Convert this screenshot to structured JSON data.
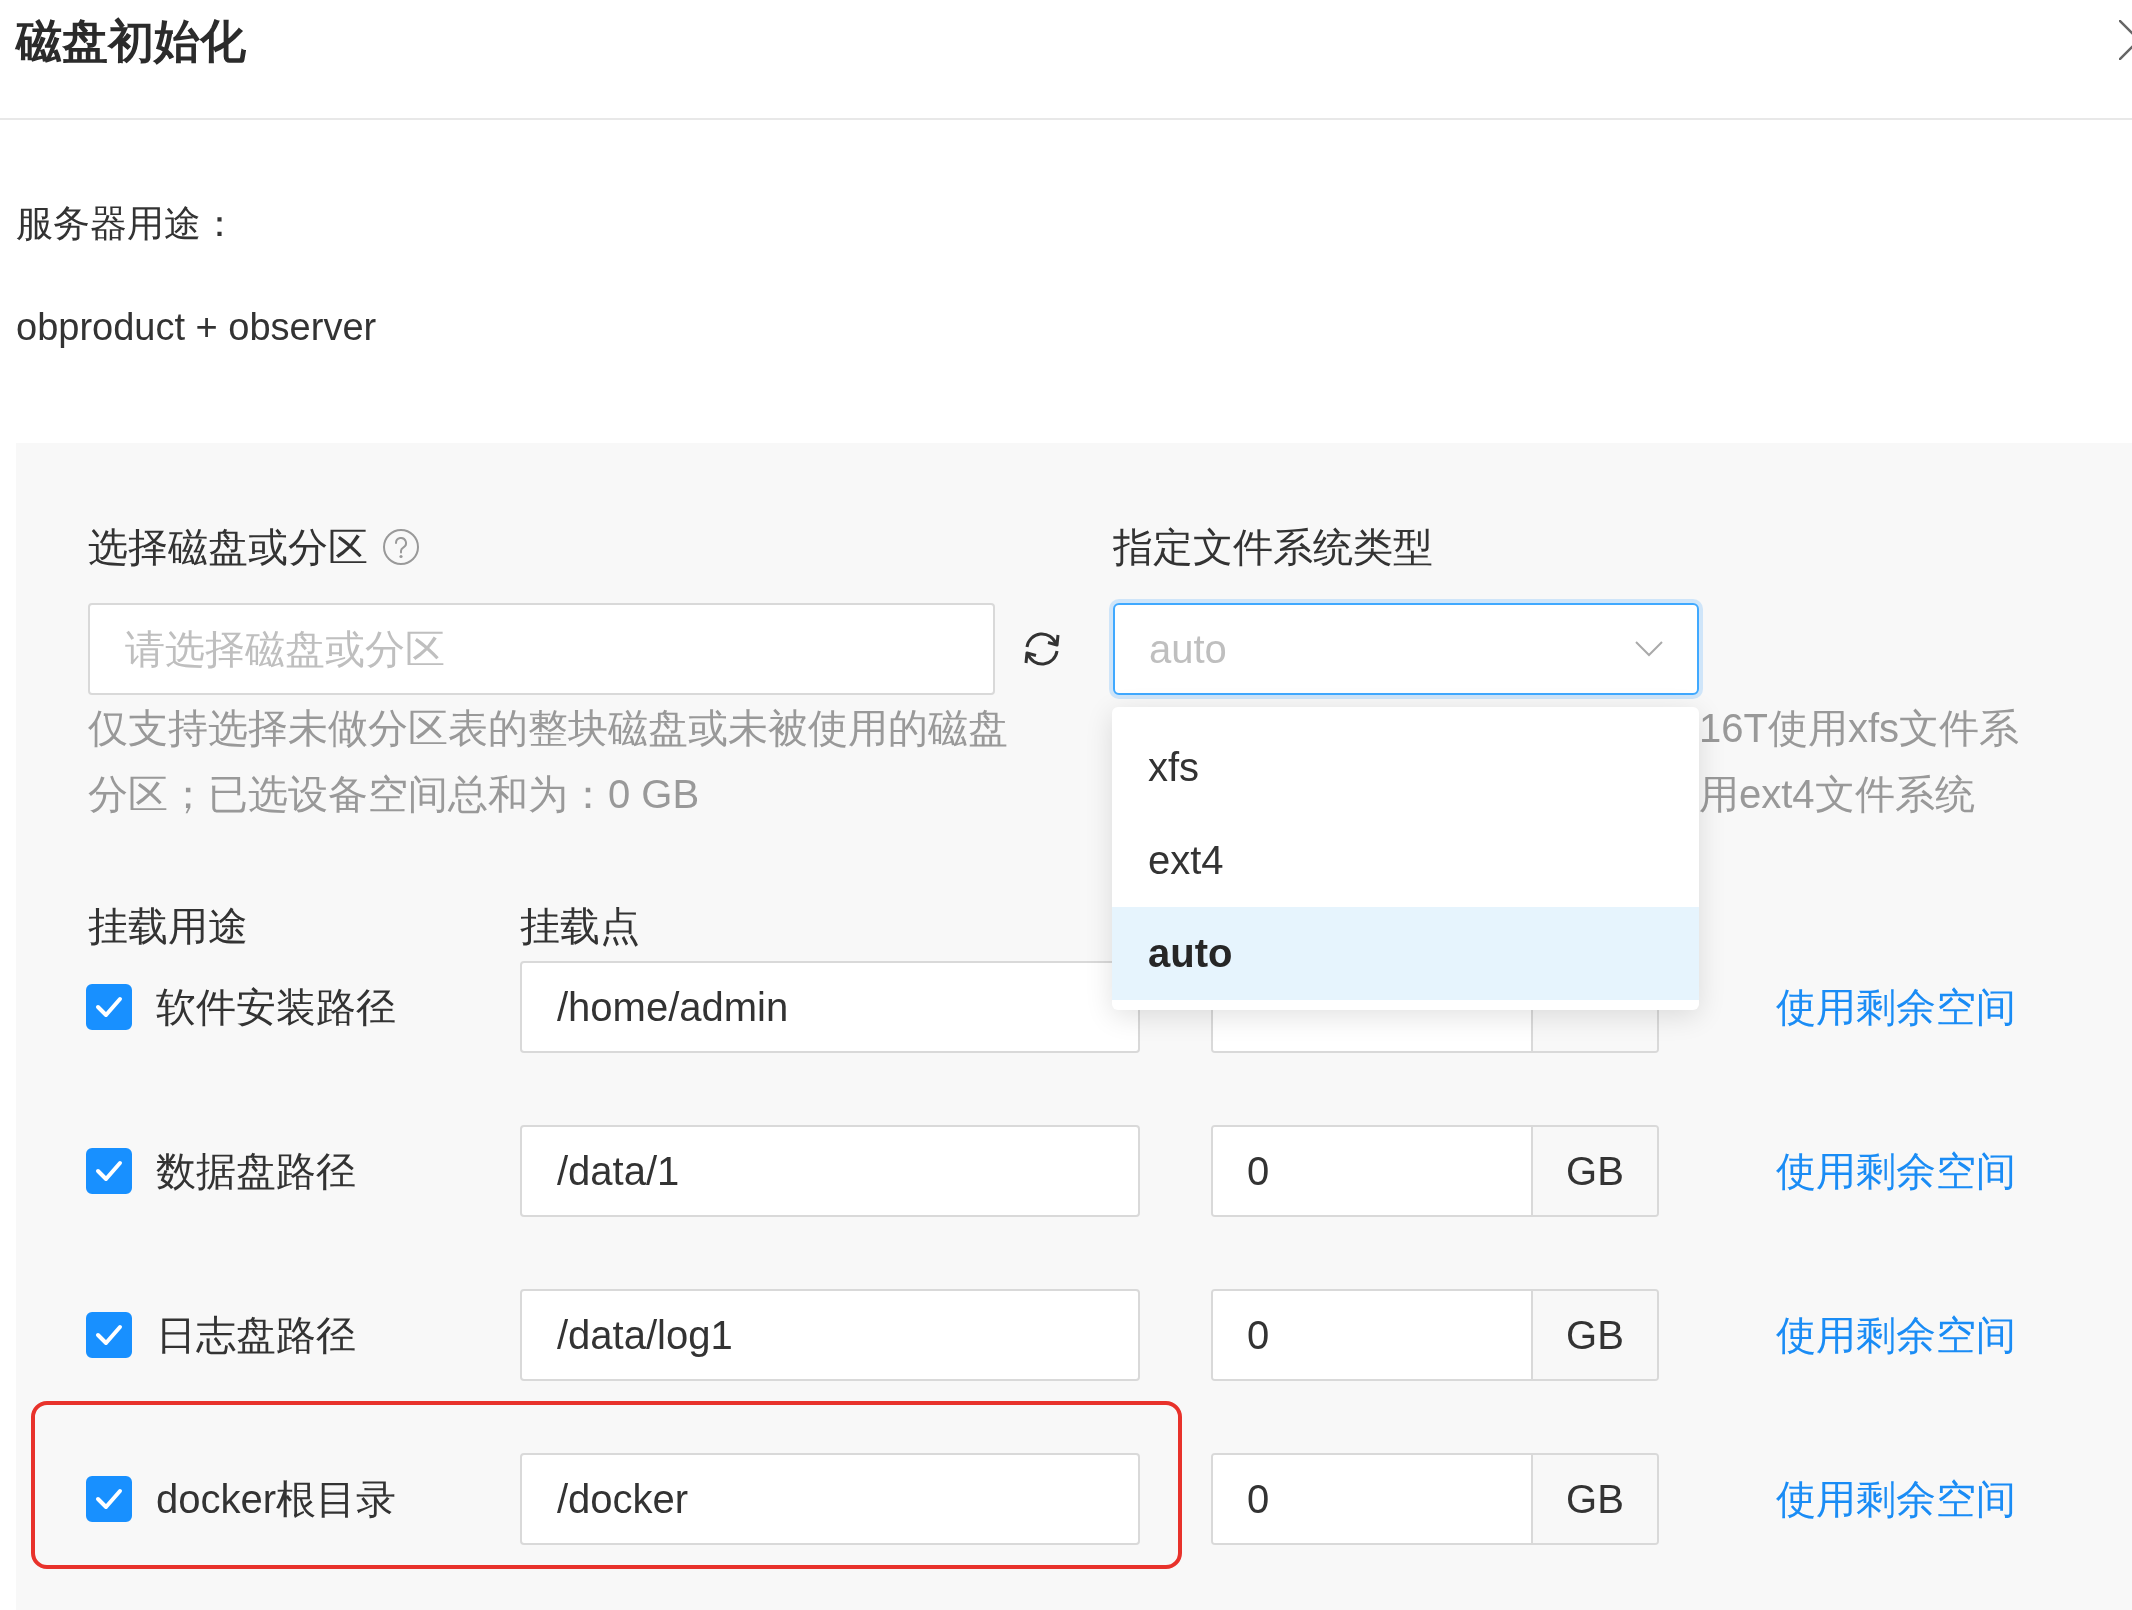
{
  "dialog": {
    "title": "磁盘初始化"
  },
  "server_usage": {
    "label": "服务器用途：",
    "value": "obproduct + observer"
  },
  "disk_select": {
    "label": "选择磁盘或分区",
    "placeholder": "请选择磁盘或分区",
    "help": "仅支持选择未做分区表的整块磁盘或未被使用的磁盘分区；已选设备空间总和为：0 GB"
  },
  "filesystem": {
    "label": "指定文件系统类型",
    "value": "auto",
    "expanded": true,
    "options": [
      {
        "label": "xfs",
        "selected": false
      },
      {
        "label": "ext4",
        "selected": false
      },
      {
        "label": "auto",
        "selected": true
      }
    ],
    "help_visible_lines": [
      "16T使用xfs文件系",
      "用ext4文件系统"
    ]
  },
  "mount_table": {
    "columns": [
      "挂载用途",
      "挂载点"
    ],
    "rows": [
      {
        "checked": true,
        "label": "软件安装路径",
        "mount_point": "/home/admin",
        "action": "使用剩余空间",
        "highlighted": false
      },
      {
        "checked": true,
        "label": "数据盘路径",
        "mount_point": "/data/1",
        "size": "0",
        "unit": "GB",
        "action": "使用剩余空间",
        "highlighted": false
      },
      {
        "checked": true,
        "label": "日志盘路径",
        "mount_point": "/data/log1",
        "size": "0",
        "unit": "GB",
        "action": "使用剩余空间",
        "highlighted": false
      },
      {
        "checked": true,
        "label": "docker根目录",
        "mount_point": "/docker",
        "size": "0",
        "unit": "GB",
        "action": "使用剩余空间",
        "highlighted": true
      }
    ]
  }
}
